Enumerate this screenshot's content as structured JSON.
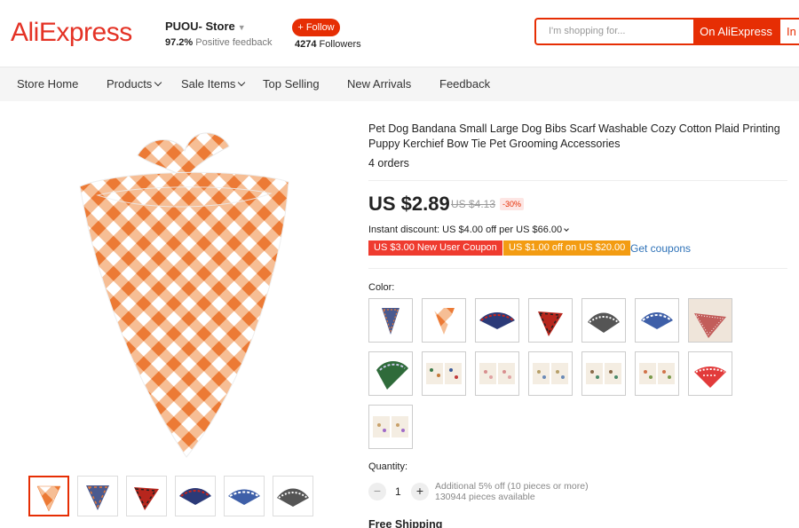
{
  "header": {
    "logo": "AliExpress",
    "store_name": "PUOU- Store",
    "positive_pct": "97.2%",
    "positive_label": "Positive feedback",
    "follow_label": "+ Follow",
    "followers_count": "4274",
    "followers_label": "Followers",
    "search_placeholder": "I'm shopping for...",
    "search_on_ali": "On AliExpress",
    "search_in_store": "In"
  },
  "nav": {
    "items": [
      {
        "label": "Store Home"
      },
      {
        "label": "Products"
      },
      {
        "label": "Sale Items"
      },
      {
        "label": "Top Selling"
      },
      {
        "label": "New Arrivals"
      },
      {
        "label": "Feedback"
      }
    ]
  },
  "product": {
    "title": "Pet Dog Bandana Small Large Dog Bibs Scarf Washable Cozy Cotton Plaid Printing Puppy Kerchief Bow Tie Pet Grooming Accessories",
    "orders": "4 orders",
    "price": "US $2.89",
    "old_price": "US $4.13",
    "discount": "-30%",
    "instant_discount": "Instant discount: US $4.00 off per US $66.00",
    "coupon1": "US $3.00 New User Coupon",
    "coupon2": "US $1.00 off on US $20.00",
    "get_coupons": "Get coupons",
    "color_label": "Color:",
    "quantity_label": "Quantity:",
    "quantity_value": "1",
    "qty_extra1": "Additional 5% off (10 pieces or more)",
    "qty_extra2": "130944 pieces available",
    "shipping": "Free Shipping"
  },
  "colors": {
    "orange_plaid": "#ef8a4c",
    "red_plaid": "#c8261c",
    "navy_plaid": "#2b3a78",
    "black_plaid": "#333333",
    "blue_plaid": "#3e5fa8",
    "green_plaid": "#2f6b3a",
    "accent": "#e62e04"
  }
}
